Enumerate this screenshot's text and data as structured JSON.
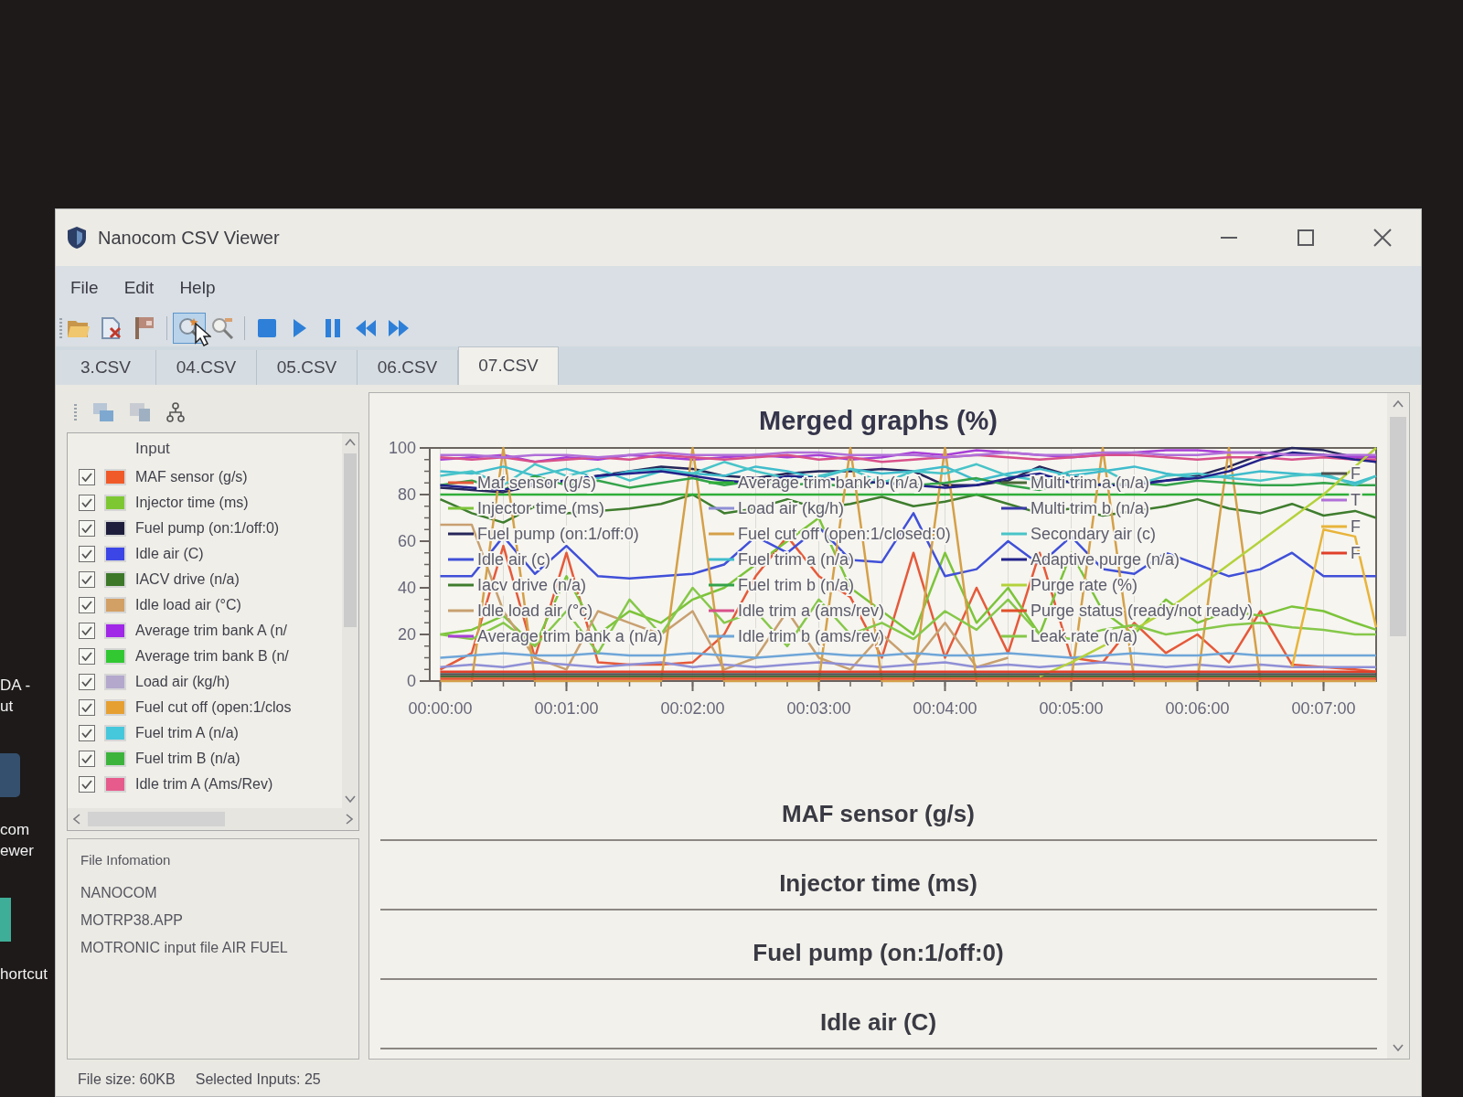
{
  "desktop": {
    "icons": [
      {
        "kind": "text",
        "lines": [
          "DA -",
          "ut"
        ]
      },
      {
        "kind": "program",
        "lines": [
          "com",
          "ewer"
        ]
      },
      {
        "kind": "tile",
        "lines": [
          "hortcut"
        ]
      }
    ]
  },
  "window": {
    "title": "Nanocom CSV Viewer"
  },
  "menu": [
    "File",
    "Edit",
    "Help"
  ],
  "toolbar": {
    "groups": [
      [
        {
          "kind": "open",
          "selected": false
        },
        {
          "kind": "delete",
          "selected": false
        },
        {
          "kind": "flag",
          "selected": false
        }
      ],
      [
        {
          "kind": "chart",
          "selected": true
        },
        {
          "kind": "zoom",
          "selected": false
        }
      ],
      [
        {
          "kind": "stop",
          "selected": false
        },
        {
          "kind": "play",
          "selected": false
        },
        {
          "kind": "pause",
          "selected": false
        },
        {
          "kind": "rewind",
          "selected": false
        },
        {
          "kind": "forward",
          "selected": false
        }
      ]
    ]
  },
  "tabs": [
    {
      "label": "3.CSV",
      "selected": false
    },
    {
      "label": "04.CSV",
      "selected": false
    },
    {
      "label": "05.CSV",
      "selected": false
    },
    {
      "label": "06.CSV",
      "selected": false
    },
    {
      "label": "07.CSV",
      "selected": true
    }
  ],
  "inputs": {
    "header": "Input",
    "items": [
      {
        "label": "MAF sensor (g/s)",
        "checked": true,
        "color": "#f05a28"
      },
      {
        "label": "Injector time (ms)",
        "checked": true,
        "color": "#7dc832"
      },
      {
        "label": "Fuel pump (on:1/off:0)",
        "checked": true,
        "color": "#1e1e3c"
      },
      {
        "label": "Idle air (C)",
        "checked": true,
        "color": "#3c46e6"
      },
      {
        "label": "IACV drive (n/a)",
        "checked": true,
        "color": "#3c7828"
      },
      {
        "label": "Idle load air (°C)",
        "checked": true,
        "color": "#d2a064"
      },
      {
        "label": "Average trim bank A (n/",
        "checked": true,
        "color": "#a028e6"
      },
      {
        "label": "Average trim bank B (n/",
        "checked": true,
        "color": "#32c832"
      },
      {
        "label": "Load air (kg/h)",
        "checked": true,
        "color": "#b4a8cc"
      },
      {
        "label": "Fuel cut off (open:1/clos",
        "checked": true,
        "color": "#e6a032"
      },
      {
        "label": "Fuel trim A (n/a)",
        "checked": true,
        "color": "#46c8dc"
      },
      {
        "label": "Fuel trim B (n/a)",
        "checked": true,
        "color": "#3cb43c"
      },
      {
        "label": "Idle trim A (Ams/Rev)",
        "checked": true,
        "color": "#e65a8c"
      }
    ]
  },
  "file_information": {
    "title": "File Infomation",
    "lines": [
      "NANOCOM",
      "MOTRP38.APP",
      "MOTRONIC input file AIR FUEL"
    ]
  },
  "main": {
    "chart_data": {
      "type": "line",
      "title": "Merged graphs (%)",
      "grid": true,
      "legend": "upper right",
      "x": [
        0,
        15,
        30,
        45,
        60,
        75,
        90,
        105,
        120,
        135,
        150,
        165,
        180,
        195,
        210,
        225,
        240,
        255,
        270,
        285,
        300,
        315,
        330,
        345,
        360,
        375,
        390,
        405,
        420,
        435,
        445
      ],
      "xlim": [
        -5,
        445
      ],
      "ylim": [
        0,
        100
      ],
      "xticks": [
        {
          "value": 0,
          "label": "00:00:00"
        },
        {
          "value": 60,
          "label": "00:01:00"
        },
        {
          "value": 120,
          "label": "00:02:00"
        },
        {
          "value": 180,
          "label": "00:03:00"
        },
        {
          "value": 240,
          "label": "00:04:00"
        },
        {
          "value": 300,
          "label": "00:05:00"
        },
        {
          "value": 360,
          "label": "00:06:00"
        },
        {
          "value": 420,
          "label": "00:07:00"
        }
      ],
      "yticks": [
        0,
        20,
        40,
        60,
        80,
        100
      ],
      "series": [
        {
          "name": "Maf sensor (g/s)",
          "color": "#e55a3a",
          "values": [
            5,
            12,
            58,
            10,
            55,
            8,
            7,
            7,
            8,
            20,
            45,
            62,
            45,
            36,
            10,
            55,
            10,
            40,
            12,
            55,
            10,
            8,
            25,
            12,
            20,
            8,
            30,
            7,
            6,
            5,
            4
          ]
        },
        {
          "name": "Injector time (ms)",
          "color": "#7cc43a",
          "values": [
            20,
            22,
            28,
            15,
            45,
            20,
            30,
            25,
            35,
            40,
            50,
            60,
            70,
            40,
            30,
            20,
            55,
            25,
            40,
            20,
            55,
            30,
            20,
            35,
            25,
            30,
            28,
            32,
            30,
            25,
            22
          ]
        },
        {
          "name": "Fuel pump (on:1/off:0)",
          "color": "#26265a",
          "values": [
            83,
            82,
            81,
            84,
            86,
            88,
            90,
            92,
            91,
            88,
            87,
            89,
            90,
            90,
            91,
            90,
            84,
            84,
            86,
            92,
            88,
            84,
            85,
            86,
            88,
            92,
            97,
            100,
            99,
            96,
            94
          ]
        },
        {
          "name": "Idle air (c)",
          "color": "#4050d8",
          "values": [
            45,
            45,
            62,
            46,
            58,
            45,
            44,
            45,
            46,
            50,
            62,
            55,
            66,
            52,
            51,
            72,
            45,
            48,
            60,
            50,
            62,
            48,
            46,
            55,
            50,
            45,
            48,
            55,
            45,
            45,
            45
          ]
        },
        {
          "name": "Iacv drive (n/a)",
          "color": "#3f7d2e",
          "values": [
            78,
            72,
            68,
            75,
            72,
            73,
            74,
            76,
            80,
            72,
            74,
            78,
            74,
            76,
            79,
            75,
            77,
            80,
            76,
            72,
            74,
            71,
            73,
            75,
            78,
            74,
            72,
            76,
            71,
            73,
            70
          ]
        },
        {
          "name": "Idle load air (°c)",
          "color": "#c8a070",
          "values": [
            67,
            67,
            30,
            10,
            5,
            30,
            25,
            20,
            30,
            5,
            10,
            30,
            10,
            5,
            20,
            8,
            25,
            6,
            10,
            null,
            null,
            null,
            null,
            null,
            null,
            null,
            null,
            null,
            null,
            null,
            null
          ]
        },
        {
          "name": "Average trim bank a (n/a)",
          "color": "#a83fd6",
          "values": [
            95,
            96,
            97,
            94,
            96,
            95,
            97,
            96,
            95,
            96,
            97,
            96,
            97,
            95,
            96,
            98,
            97,
            99,
            98,
            97,
            96,
            97,
            98,
            99,
            99,
            98,
            98,
            97,
            97,
            96,
            96
          ]
        },
        {
          "name": "Average trim bank b (n/a)",
          "color": "#2fae3a",
          "values": [
            80,
            80,
            80,
            80,
            80,
            80,
            80,
            80,
            80,
            80,
            80,
            80,
            80,
            80,
            80,
            80,
            80,
            80,
            80,
            80,
            80,
            80,
            80,
            80,
            80,
            80,
            80,
            80,
            80,
            80,
            80
          ]
        },
        {
          "name": "Load air (kg/h)",
          "color": "#8f8fd6",
          "values": [
            6,
            7,
            6,
            8,
            7,
            6,
            7,
            8,
            6,
            7,
            6,
            7,
            8,
            7,
            6,
            7,
            8,
            6,
            7,
            6,
            7,
            8,
            7,
            6,
            7,
            6,
            7,
            6,
            6,
            6,
            6
          ]
        },
        {
          "name": "Fuel cut off (open:1/closed:0)",
          "color": "#d4a048",
          "values": [
            0,
            0,
            100,
            0,
            0,
            0,
            0,
            0,
            100,
            0,
            0,
            0,
            0,
            100,
            0,
            0,
            100,
            0,
            0,
            0,
            0,
            100,
            0,
            0,
            0,
            100,
            0,
            0,
            0,
            0,
            0
          ]
        },
        {
          "name": "Fuel trim a (n/a)",
          "color": "#3fbccc",
          "values": [
            90,
            89,
            92,
            88,
            91,
            87,
            90,
            91,
            89,
            88,
            92,
            90,
            87,
            91,
            89,
            90,
            92,
            86,
            89,
            91,
            88,
            90,
            92,
            89,
            87,
            88,
            90,
            89,
            88,
            85,
            88
          ]
        },
        {
          "name": "Fuel trim b (n/a)",
          "color": "#34a34a",
          "values": [
            84,
            86,
            82,
            88,
            84,
            86,
            83,
            85,
            87,
            84,
            86,
            84,
            85,
            83,
            86,
            84,
            85,
            87,
            84,
            82,
            86,
            84,
            85,
            84,
            86,
            85,
            84,
            84,
            85,
            84,
            84
          ]
        },
        {
          "name": "Idle trim a (ams/rev)",
          "color": "#d8508a",
          "values": [
            96,
            95,
            96,
            94,
            95,
            96,
            95,
            97,
            96,
            95,
            96,
            97,
            95,
            96,
            94,
            95,
            96,
            97,
            96,
            95,
            96,
            97,
            97,
            96,
            95,
            96,
            96,
            95,
            96,
            95,
            95
          ]
        },
        {
          "name": "Idle trim b (ams/rev)",
          "color": "#6fa6d8",
          "values": [
            10,
            11,
            12,
            11,
            11,
            12,
            11,
            11,
            12,
            11,
            10,
            11,
            12,
            11,
            11,
            12,
            11,
            11,
            12,
            11,
            10,
            11,
            12,
            11,
            11,
            12,
            11,
            11,
            11,
            11,
            11
          ]
        },
        {
          "name": "Multi trim a (n/a)",
          "color": "#4a6a3a",
          "values": [
            2,
            2,
            2,
            2,
            2,
            2,
            2,
            2,
            2,
            2,
            2,
            2,
            2,
            2,
            2,
            2,
            2,
            2,
            2,
            2,
            2,
            2,
            2,
            2,
            2,
            2,
            2,
            2,
            2,
            2,
            2
          ]
        },
        {
          "name": "Multi trim b (n/a)",
          "color": "#3a3aa8",
          "values": [
            null,
            null,
            null,
            null,
            null,
            null,
            null,
            null,
            null,
            null,
            null,
            null,
            null,
            null,
            null,
            null,
            null,
            null,
            null,
            null,
            null,
            null,
            null,
            null,
            null,
            null,
            null,
            null,
            null,
            null,
            null
          ]
        },
        {
          "name": "Secondary air (c)",
          "color": "#48c4c8",
          "values": [
            88,
            90,
            84,
            93,
            88,
            91,
            86,
            90,
            89,
            94,
            90,
            87,
            88,
            91,
            85,
            90,
            89,
            93,
            88,
            86,
            90,
            91,
            84,
            88,
            89,
            87,
            86,
            88,
            89,
            84,
            88
          ]
        },
        {
          "name": "Adaptive purge (n/a)",
          "color": "#22228a",
          "values": [
            84,
            83,
            82,
            85,
            86,
            88,
            89,
            90,
            88,
            86,
            85,
            88,
            87,
            86,
            85,
            84,
            83,
            84,
            87,
            89,
            85,
            84,
            84,
            86,
            87,
            90,
            95,
            98,
            97,
            95,
            94
          ]
        },
        {
          "name": "Purge rate (%)",
          "color": "#b4d23c",
          "values": [
            null,
            null,
            null,
            null,
            null,
            null,
            null,
            null,
            null,
            null,
            null,
            null,
            null,
            null,
            null,
            null,
            null,
            null,
            null,
            2,
            8,
            15,
            22,
            30,
            40,
            50,
            60,
            70,
            80,
            92,
            100
          ]
        },
        {
          "name": "Purge status (ready/not ready)",
          "color": "#e0502a",
          "values": [
            1,
            1,
            1,
            1,
            1,
            1,
            1,
            1,
            1,
            1,
            1,
            1,
            1,
            1,
            1,
            1,
            1,
            1,
            1,
            1,
            1,
            1,
            1,
            1,
            1,
            1,
            1,
            1,
            1,
            1,
            1
          ]
        },
        {
          "name": "Leak rate (n/a)",
          "color": "#86c84a",
          "values": [
            20,
            18,
            25,
            15,
            30,
            12,
            35,
            20,
            40,
            25,
            30,
            15,
            35,
            20,
            25,
            18,
            30,
            22,
            35,
            20,
            18,
            22,
            24,
            20,
            22,
            24,
            25,
            23,
            22,
            20,
            20
          ]
        },
        {
          "name": "F",
          "color": "#505050",
          "values": [
            3,
            3,
            3,
            3,
            3,
            3,
            3,
            3,
            3,
            3,
            3,
            3,
            3,
            3,
            3,
            3,
            3,
            3,
            3,
            3,
            3,
            3,
            3,
            3,
            3,
            3,
            3,
            3,
            3,
            3,
            3
          ]
        },
        {
          "name": "T",
          "color": "#b070d8",
          "values": [
            97,
            97,
            96,
            97,
            97,
            96,
            97,
            98,
            97,
            97,
            97,
            98,
            98,
            97,
            97,
            97,
            96,
            97,
            98,
            97,
            97,
            98,
            98,
            97,
            97,
            98,
            98,
            97,
            97,
            97,
            97
          ]
        },
        {
          "name": "F",
          "color": "#e8b43a",
          "values": [
            null,
            null,
            null,
            null,
            null,
            null,
            null,
            null,
            null,
            null,
            null,
            null,
            null,
            null,
            null,
            null,
            null,
            null,
            null,
            null,
            null,
            null,
            null,
            null,
            null,
            null,
            null,
            6,
            65,
            62,
            23
          ]
        },
        {
          "name": "F",
          "color": "#e0402a",
          "values": [
            4,
            4,
            4,
            4,
            4,
            4,
            4,
            4,
            4,
            4,
            4,
            4,
            4,
            4,
            4,
            4,
            4,
            4,
            4,
            4,
            4,
            4,
            4,
            4,
            4,
            4,
            4,
            4,
            4,
            4,
            4
          ]
        }
      ]
    },
    "graphs": [
      "MAF sensor (g/s)",
      "Injector time (ms)",
      "Fuel pump (on:1/off:0)",
      "Idle air (C)"
    ]
  },
  "status_bar": [
    "File size: 60KB",
    "Selected Inputs: 25"
  ]
}
